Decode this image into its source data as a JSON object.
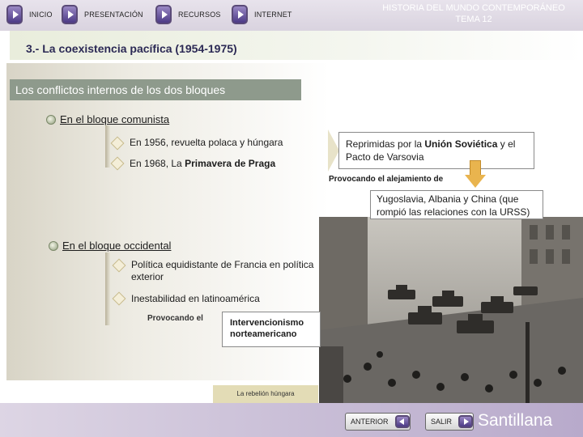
{
  "nav": {
    "inicio": "INICIO",
    "presentacion": "PRESENTACIÓN",
    "recursos": "RECURSOS",
    "internet": "INTERNET"
  },
  "header": {
    "line1": "HISTORIA DEL MUNDO CONTEMPORÁNEO",
    "line2": "TEMA 12"
  },
  "section_title": "3.- La coexistencia pacífica (1954-1975)",
  "subheading": "Los conflictos internos de los dos bloques",
  "communist": {
    "label": "En el bloque comunista",
    "item1": "En 1956, revuelta polaca y húngara",
    "item2_pre": "En 1968, La ",
    "item2_bold": "Primavera de Praga",
    "callout_pre": "Reprimidas por la ",
    "callout_bold": "Unión Soviética",
    "callout_post": " y el Pacto de Varsovia",
    "provoking": "Provocando el alejamiento de",
    "result": "Yugoslavia, Albania y China (que rompió las relaciones con la URSS)"
  },
  "western": {
    "label": "En el bloque occidental",
    "item1": "Política equidistante de Francia en política exterior",
    "item2": "Inestabilidad en latinoamérica",
    "provoking": "Provocando el",
    "result": "Intervencionismo norteamericano"
  },
  "photo_caption": "La rebelión húngara",
  "footer": {
    "prev": "ANTERIOR",
    "exit": "SALIR",
    "brand": "Santillana"
  },
  "colors": {
    "nav_arrow": "#4c3a86",
    "title_text": "#2c2a55",
    "subhead_bg": "#8e9a8c",
    "arrow_orange": "#e9b44e"
  }
}
